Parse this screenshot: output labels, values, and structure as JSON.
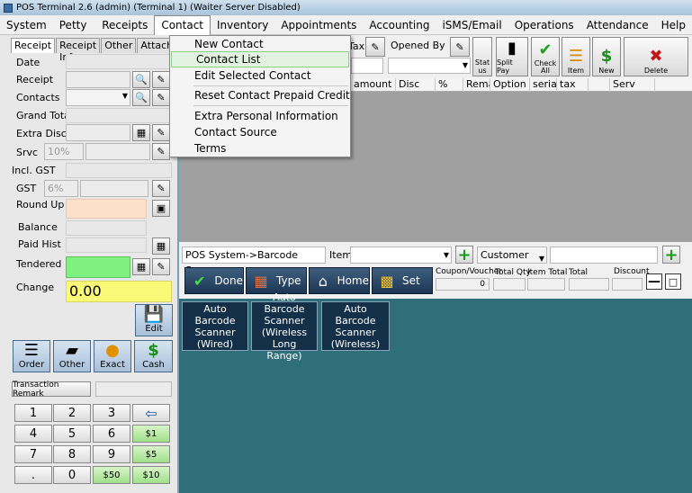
{
  "window": {
    "title": "POS Terminal 2.6 (admin) (Terminal 1) (Waiter Server Disabled)"
  },
  "menu": {
    "items": [
      "System",
      "Petty Cash",
      "Receipts",
      "Contact",
      "Inventory",
      "Appointments",
      "Accounting",
      "iSMS/Email",
      "Operations",
      "Attendance",
      "Help"
    ]
  },
  "contact_menu": {
    "items": [
      "New Contact",
      "Contact List",
      "Edit Selected Contact",
      "Reset Contact Prepaid Credit",
      "Extra Personal Information",
      "Contact Source",
      "Terms"
    ]
  },
  "left": {
    "tabs": [
      "Receipt",
      "Receipt Info",
      "Other",
      "Attach"
    ],
    "labels": {
      "date": "Date",
      "receipt": "Receipt",
      "contacts": "Contacts",
      "grand_total": "Grand Total",
      "extra_disc": "Extra Disc",
      "srvc": "Srvc",
      "incl_gst": "Incl. GST",
      "gst": "GST",
      "round_up": "Round Up",
      "balance": "Balance",
      "paid_hist": "Paid Hist",
      "tendered": "Tendered",
      "change": "Change"
    },
    "srvc_value": "10%",
    "gst_value": "6%",
    "change_value": "0.00",
    "edit_label": "Edit",
    "pay_buttons": [
      "Order",
      "Other",
      "Exact",
      "Cash"
    ],
    "transaction_remark": "Transaction Remark",
    "keypad": [
      "1",
      "2",
      "3",
      "4",
      "5",
      "6",
      "$1",
      "7",
      "8",
      "9",
      "$5",
      ".",
      "0",
      "$50",
      "$10"
    ]
  },
  "toolbar": {
    "tax_label": "Tax",
    "opened_by": "Opened By",
    "status": "Status",
    "split_pay": "Split Pay",
    "check_all": "Check All",
    "item": "Item",
    "new": "New",
    "delete": "Delete"
  },
  "grid": {
    "columns": [
      "amount",
      "Disc",
      "%",
      "Remark",
      "Option",
      "serial",
      "tax",
      "",
      "Serv"
    ]
  },
  "scanner": {
    "path": "POS System->Barcode Scanner",
    "item_label": "Item",
    "customer": "Customer",
    "coupon_label": "Coupon/Voucher",
    "coupon_value": "0",
    "total_qty": "Total Qty",
    "item_total": "Item Total",
    "total": "Total",
    "discount": "Discount"
  },
  "actions": {
    "done": "Done",
    "type": "Type",
    "home": "Home",
    "set": "Set"
  },
  "scan_buttons": [
    "Auto Barcode Scanner (Wired)",
    "Auto Barcode Scanner (Wireless Long Range)",
    "Auto Barcode Scanner (Wireless)"
  ],
  "colors": {
    "round_up_bg": "#fde0c8",
    "tendered_bg": "#80f080",
    "change_bg": "#fafa78",
    "highlight": "#8fd08f"
  }
}
